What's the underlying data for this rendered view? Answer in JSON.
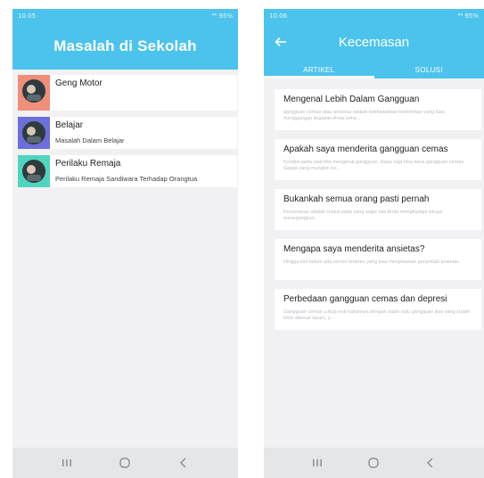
{
  "left": {
    "status": {
      "time": "10.05",
      "right": "⁴⁸ 95%"
    },
    "title": "Masalah di Sekolah",
    "items": [
      {
        "title": "Geng Motor",
        "subtitle": "",
        "accent": "#ee8f7a"
      },
      {
        "title": "Belajar",
        "subtitle": "Masalah Dalam Belajar",
        "accent": "#6d6fd8"
      },
      {
        "title": "Perilaku Remaja",
        "subtitle": "Perilaku Remaja Sandiwara Terhadap Orangtua",
        "accent": "#4fd4bf"
      }
    ]
  },
  "right": {
    "status": {
      "time": "10.06",
      "right": "⁴⁸ 95%"
    },
    "title": "Kecemasan",
    "tabs": [
      "ARTIKEL",
      "SOLUSI"
    ],
    "articles": [
      {
        "title": "Mengenal Lebih Dalam Gangguan",
        "snippet": "gangguan cemas atau ansietas adalah kekhawatiran berlebihan yang bisa mengganggu kegiatan Anda seha..."
      },
      {
        "title": "Apakah saya menderita gangguan cemas",
        "snippet": "Kondisi pada saat kita mengenal gangguan, siapa saja bisa kena gangguan cemas. Gejala yang mungkin ke..."
      },
      {
        "title": "Bukankah semua orang pasti pernah",
        "snippet": "Kecemasan adalah reaksi pada yang wajar bila Anda menghadapi situasi menegangkan."
      },
      {
        "title": "Mengapa saya menderita ansietas?",
        "snippet": "Hingga kini belum ada nomor tertentu yang bisa menjelaskan penyebab ansietas."
      },
      {
        "title": "Perbedaan gangguan cemas dan depresi",
        "snippet": "Gangguan cemas cukup erat kaitannya dengan salah satu gangguan jiwa yang sudah lebih dikenal awam, y..."
      }
    ]
  },
  "colors": {
    "primary": "#4cc3ec",
    "background": "#f1f1f3",
    "navbar": "#e5e6e8"
  },
  "icons": [
    "arrow-left-icon",
    "recents-icon",
    "home-icon",
    "back-icon",
    "avatar-photo"
  ]
}
